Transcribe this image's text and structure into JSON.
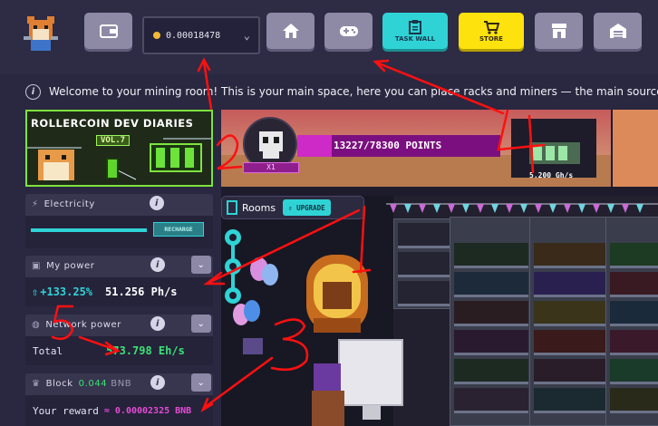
{
  "topbar": {
    "wallet_balance": "0.00018478",
    "buttons": [
      {
        "name": "wallet",
        "icon": "wallet-icon",
        "label": ""
      },
      {
        "name": "home",
        "icon": "home-icon",
        "label": ""
      },
      {
        "name": "games",
        "icon": "gamepad-icon",
        "label": ""
      },
      {
        "name": "task-wall",
        "icon": "clipboard-icon",
        "label": "TASK WALL"
      },
      {
        "name": "store",
        "icon": "cart-icon",
        "label": "STORE"
      },
      {
        "name": "marketplace",
        "icon": "shop-icon",
        "label": ""
      },
      {
        "name": "garage",
        "icon": "garage-icon",
        "label": ""
      }
    ]
  },
  "welcome": {
    "text": "Welcome to your mining room! This is your main space, here you can place racks and miners — the main source of mining powe"
  },
  "dev_banner": {
    "title": "ROLLERCOIN DEV DIARIES",
    "volume": "VOL.7"
  },
  "level": {
    "progress_text": "13227/78300  POINTS",
    "progress_fraction": 0.169,
    "level_label": "X1"
  },
  "stat_card": {
    "value": "5.200 Gh/s"
  },
  "rooms": {
    "label": "Rooms",
    "upgrade_label": "UPGRADE"
  },
  "panels": {
    "electricity": {
      "title": "Electricity",
      "recharge_label": "RECHARGE",
      "level_fraction": 0.62
    },
    "my_power": {
      "title": "My power",
      "bonus": "+133.25%",
      "value": "51.256 Ph/s"
    },
    "network_power": {
      "title": "Network power",
      "total_label": "Total",
      "value": "573.798 Eh/s"
    },
    "block": {
      "title_prefix": "Block",
      "amount": "0.044",
      "currency": "BNB",
      "reward_label": "Your reward",
      "reward_value": "≈ 0.00002325 BNB"
    }
  },
  "annotations": [
    "2",
    "3",
    "4",
    "5"
  ],
  "colors": {
    "accent_teal": "#2fd3d6",
    "accent_yellow": "#fde20e",
    "power_green": "#3ae374",
    "reward_pink": "#e64ad6",
    "annotation_red": "#ff1010"
  }
}
